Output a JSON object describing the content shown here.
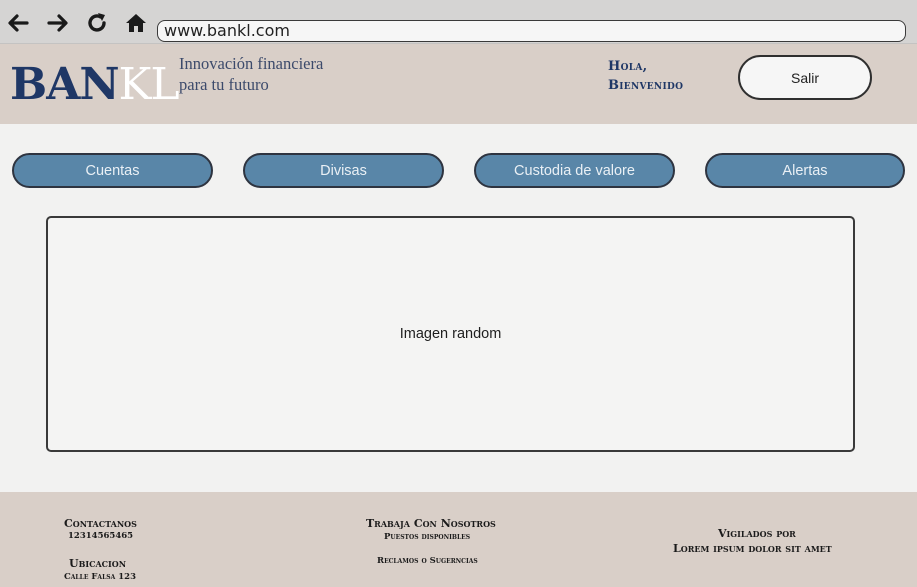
{
  "browser": {
    "url": "www.bankl.com",
    "icons": [
      "back-arrow-icon",
      "forward-arrow-icon",
      "reload-icon",
      "home-icon"
    ]
  },
  "header": {
    "logo_part1": "BAN",
    "logo_part2": "KL",
    "tagline": "Innovación financiera para tu futuro",
    "greeting_line1": "Hola,",
    "greeting_line2": "Bienvenido",
    "logout_label": "Salir"
  },
  "tabs": [
    {
      "label": "Cuentas"
    },
    {
      "label": "Divisas"
    },
    {
      "label": "Custodia de valore"
    },
    {
      "label": "Alertas"
    }
  ],
  "main": {
    "image_placeholder": "Imagen random"
  },
  "footer": {
    "contact_title": "Contactanos",
    "contact_phone": "12314565465",
    "location_title": "Ubicacion",
    "location_address": "Calle Falsa 123",
    "jobs_title": "Trabaja Con Nosotros",
    "jobs_sub": "Puestos disponibles",
    "complaints": "Reclamos o Sugerncias",
    "supervised_title": "Vigilados por",
    "supervised_by": "Lorem ipsum dolor sit amet"
  },
  "colors": {
    "brand_navy": "#1f3766",
    "tab_blue": "#5986a8",
    "header_beige": "#d9cfc8"
  }
}
